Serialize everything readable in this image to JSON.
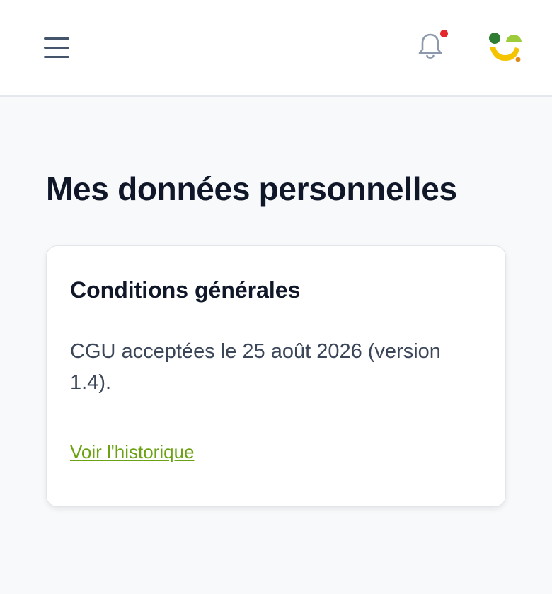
{
  "header": {
    "menu_icon": "hamburger-menu-icon",
    "notification_icon": "bell-icon",
    "notification_dot_color": "#e5262d",
    "logo_icon": "brand-logo-icon"
  },
  "page": {
    "title": "Mes données personnelles"
  },
  "terms_card": {
    "title": "Conditions générales",
    "text": "CGU acceptées le 25 août 2026 (version 1.4).",
    "history_link": "Voir l'historique",
    "link_color": "#6aa214"
  },
  "colors": {
    "background": "#f7f9fb",
    "title": "#0f1729",
    "logo_green": "#2e7d32",
    "logo_light_green": "#9ccc3a",
    "logo_yellow": "#f5c400",
    "logo_orange": "#e08a1e"
  }
}
